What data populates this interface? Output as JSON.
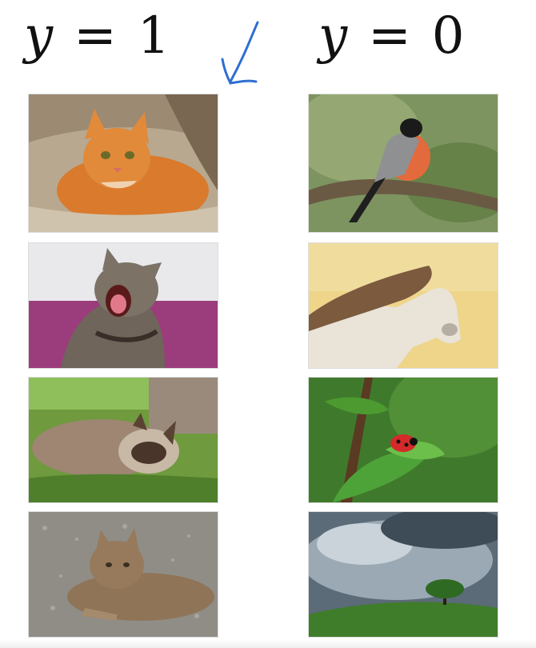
{
  "labels": {
    "left": {
      "variable": "y",
      "equals": "=",
      "value": "1"
    },
    "right": {
      "variable": "y",
      "equals": "=",
      "value": "0"
    }
  },
  "annotation": {
    "icon": "handwritten-arrow-icon",
    "color": "#2e6fd1"
  },
  "columns": {
    "positive": [
      {
        "icon": "cat-ginger-icon"
      },
      {
        "icon": "cat-yawning-icon"
      },
      {
        "icon": "cat-lying-grass-icon"
      },
      {
        "icon": "cat-gravel-icon"
      }
    ],
    "negative": [
      {
        "icon": "bird-bullfinch-icon"
      },
      {
        "icon": "horse-icon"
      },
      {
        "icon": "ladybug-leaf-icon"
      },
      {
        "icon": "tree-landscape-icon"
      }
    ]
  }
}
